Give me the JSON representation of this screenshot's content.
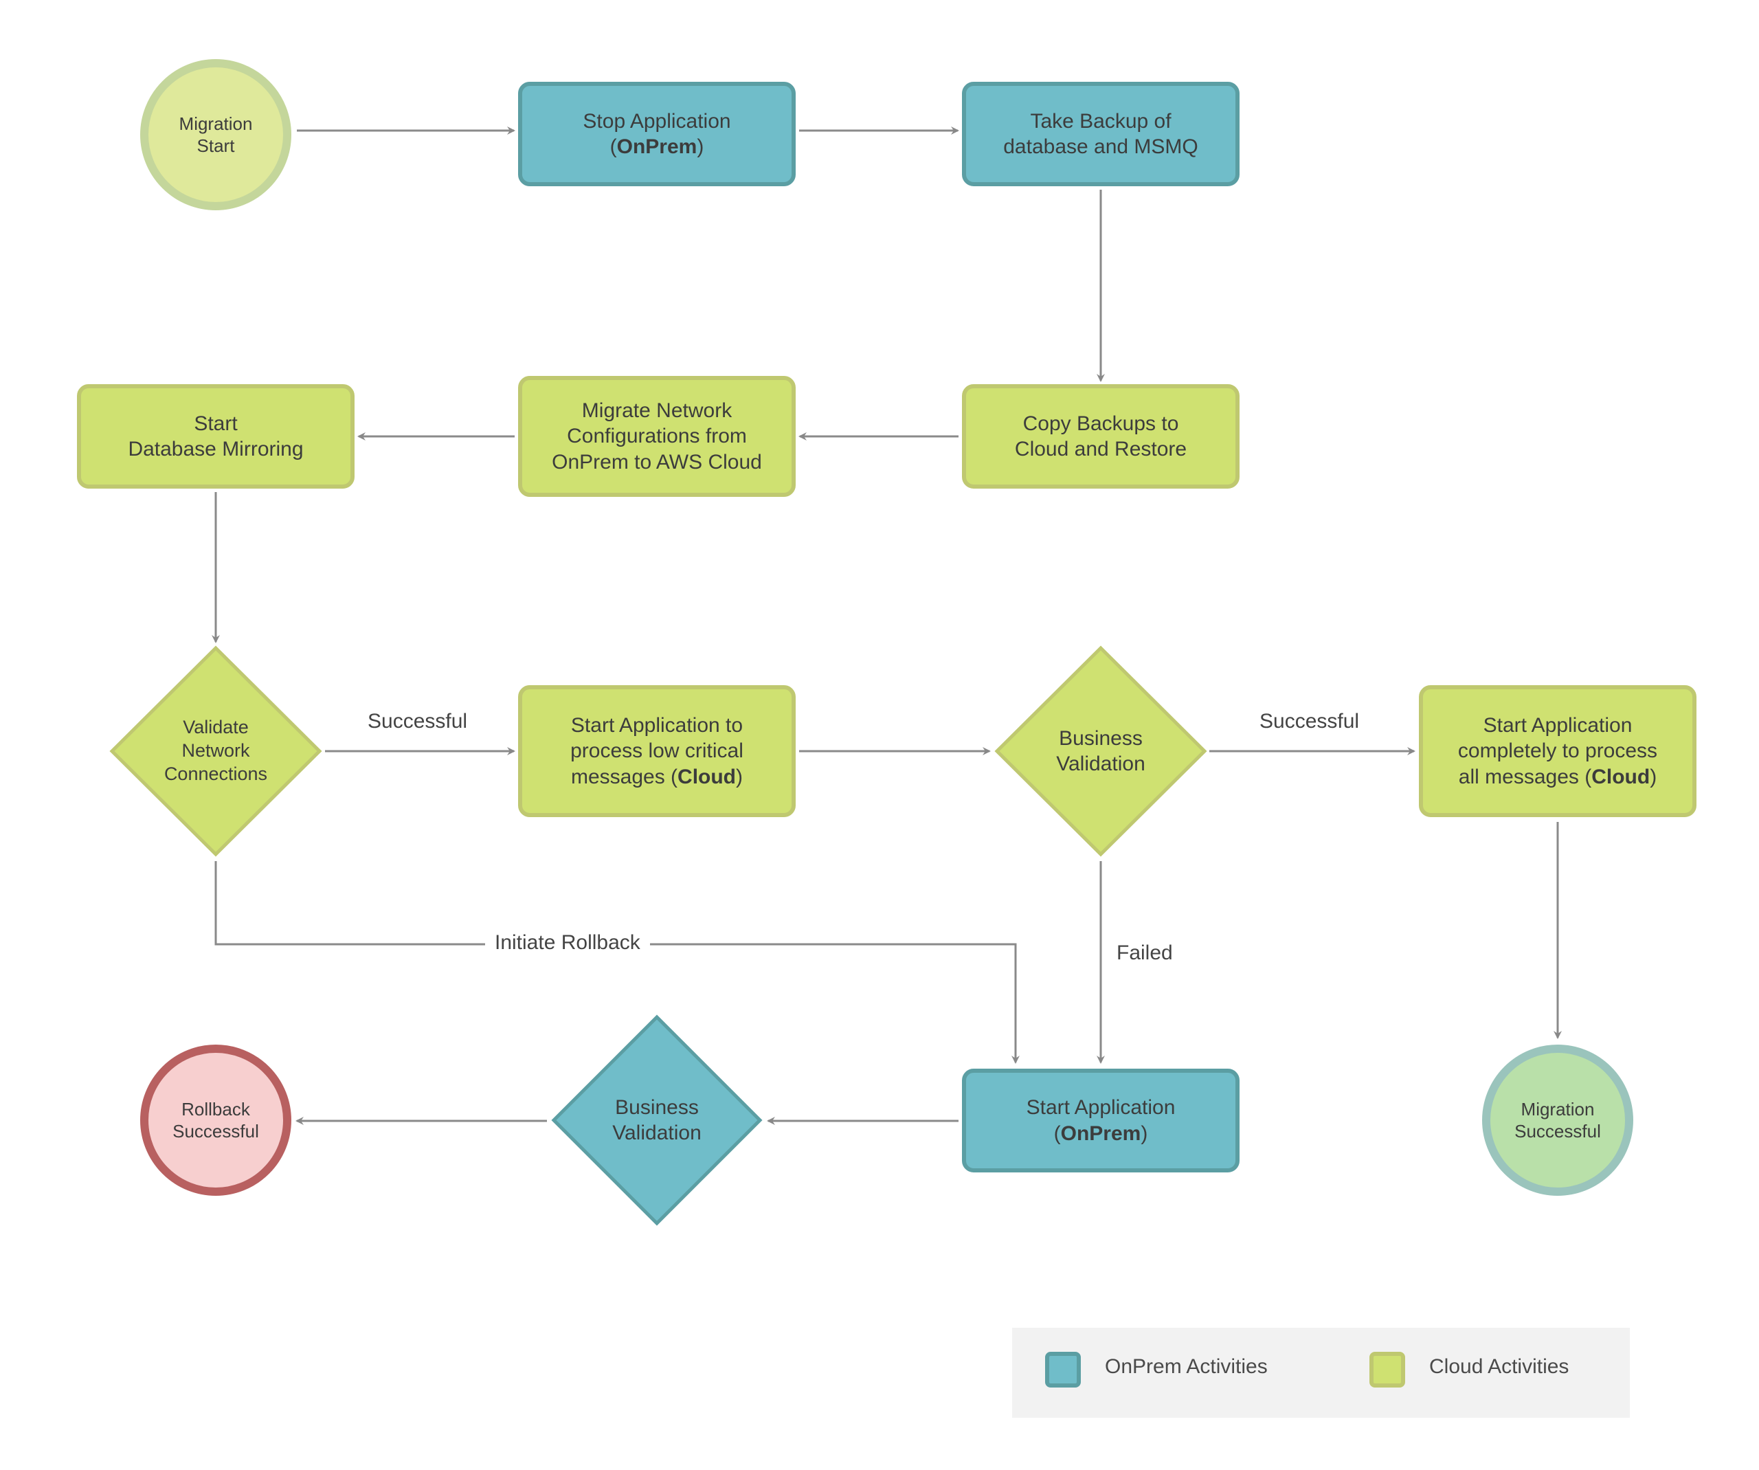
{
  "colors": {
    "onprem_fill": "#70bdc9",
    "onprem_stroke": "#5b9ea3",
    "cloud_fill": "#cfe171",
    "cloud_stroke": "#bfc870",
    "start_fill": "#dfe99b",
    "start_stroke": "#c4d69b",
    "success_fill": "#b9e0a9",
    "success_stroke": "#9ac4bc",
    "rollback_fill": "#f7cfcf",
    "rollback_stroke": "#b86060",
    "arrow": "#888888",
    "legend_bg": "#f2f2f2"
  },
  "nodes": {
    "migration_start": {
      "line1": "Migration",
      "line2": "Start",
      "type": "start"
    },
    "stop_app": {
      "line1": "Stop Application",
      "line2_pre": "(",
      "line2_bold": "OnPrem",
      "line2_post": ")",
      "type": "onprem"
    },
    "take_backup": {
      "line1": "Take Backup of",
      "line2": "database and MSMQ",
      "type": "onprem"
    },
    "copy_backups": {
      "line1": "Copy Backups to",
      "line2": "Cloud and Restore",
      "type": "cloud"
    },
    "migrate_network": {
      "line1": "Migrate Network",
      "line2": "Configurations from",
      "line3": "OnPrem to AWS Cloud",
      "type": "cloud"
    },
    "start_mirroring": {
      "line1": "Start",
      "line2": "Database Mirroring",
      "type": "cloud"
    },
    "validate_network": {
      "line1": "Validate",
      "line2": "Network",
      "line3": "Connections",
      "type": "cloud-decision"
    },
    "start_app_low": {
      "line1": "Start Application to",
      "line2": "process low critical",
      "line3_pre": "messages (",
      "line3_bold": "Cloud",
      "line3_post": ")",
      "type": "cloud"
    },
    "business_validation_cloud": {
      "line1": "Business",
      "line2": "Validation",
      "type": "cloud-decision"
    },
    "start_app_all": {
      "line1": "Start Application",
      "line2": "completely to process",
      "line3_pre": "all messages (",
      "line3_bold": "Cloud",
      "line3_post": ")",
      "type": "cloud"
    },
    "migration_successful": {
      "line1": "Migration",
      "line2": "Successful",
      "type": "success"
    },
    "start_app_onprem": {
      "line1": "Start Application",
      "line2_pre": "(",
      "line2_bold": "OnPrem",
      "line2_post": ")",
      "type": "onprem"
    },
    "business_validation_onprem": {
      "line1": "Business",
      "line2": "Validation",
      "type": "onprem-decision"
    },
    "rollback_successful": {
      "line1": "Rollback",
      "line2": "Successful",
      "type": "rollback"
    }
  },
  "edges": [
    {
      "from": "migration_start",
      "to": "stop_app",
      "label": ""
    },
    {
      "from": "stop_app",
      "to": "take_backup",
      "label": ""
    },
    {
      "from": "take_backup",
      "to": "copy_backups",
      "label": ""
    },
    {
      "from": "copy_backups",
      "to": "migrate_network",
      "label": ""
    },
    {
      "from": "migrate_network",
      "to": "start_mirroring",
      "label": ""
    },
    {
      "from": "start_mirroring",
      "to": "validate_network",
      "label": ""
    },
    {
      "from": "validate_network",
      "to": "start_app_low",
      "label": "Successful"
    },
    {
      "from": "start_app_low",
      "to": "business_validation_cloud",
      "label": ""
    },
    {
      "from": "business_validation_cloud",
      "to": "start_app_all",
      "label": "Successful"
    },
    {
      "from": "start_app_all",
      "to": "migration_successful",
      "label": ""
    },
    {
      "from": "validate_network",
      "to": "start_app_onprem",
      "label": "Initiate Rollback"
    },
    {
      "from": "business_validation_cloud",
      "to": "start_app_onprem",
      "label": "Failed"
    },
    {
      "from": "start_app_onprem",
      "to": "business_validation_onprem",
      "label": ""
    },
    {
      "from": "business_validation_onprem",
      "to": "rollback_successful",
      "label": ""
    }
  ],
  "edge_labels": {
    "successful_1": "Successful",
    "successful_2": "Successful",
    "initiate_rollback": "Initiate Rollback",
    "failed": "Failed"
  },
  "legend": {
    "onprem_label": "OnPrem Activities",
    "cloud_label": "Cloud Activities"
  }
}
